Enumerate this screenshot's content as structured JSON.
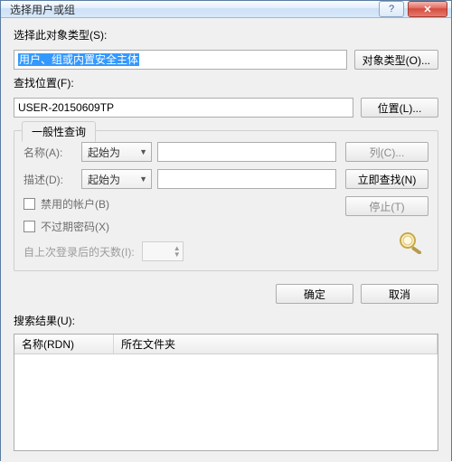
{
  "titlebar": {
    "title": "选择用户或组",
    "help_icon": "?",
    "close_icon": "✕"
  },
  "object_type": {
    "label": "选择此对象类型(S):",
    "value": "用户、组或内置安全主体",
    "button": "对象类型(O)..."
  },
  "location": {
    "label": "查找位置(F):",
    "value": "USER-20150609TP",
    "button": "位置(L)..."
  },
  "query": {
    "tab_label": "一般性查询",
    "name_label": "名称(A):",
    "name_combo": "起始为",
    "desc_label": "描述(D):",
    "desc_combo": "起始为",
    "chk_disabled": "禁用的帐户(B)",
    "chk_noexpire": "不过期密码(X)",
    "days_label": "自上次登录后的天数(I):",
    "btn_columns": "列(C)...",
    "btn_findnow": "立即查找(N)",
    "btn_stop": "停止(T)"
  },
  "footer": {
    "ok": "确定",
    "cancel": "取消"
  },
  "results": {
    "label": "搜索结果(U):",
    "col_name": "名称(RDN)",
    "col_folder": "所在文件夹"
  }
}
